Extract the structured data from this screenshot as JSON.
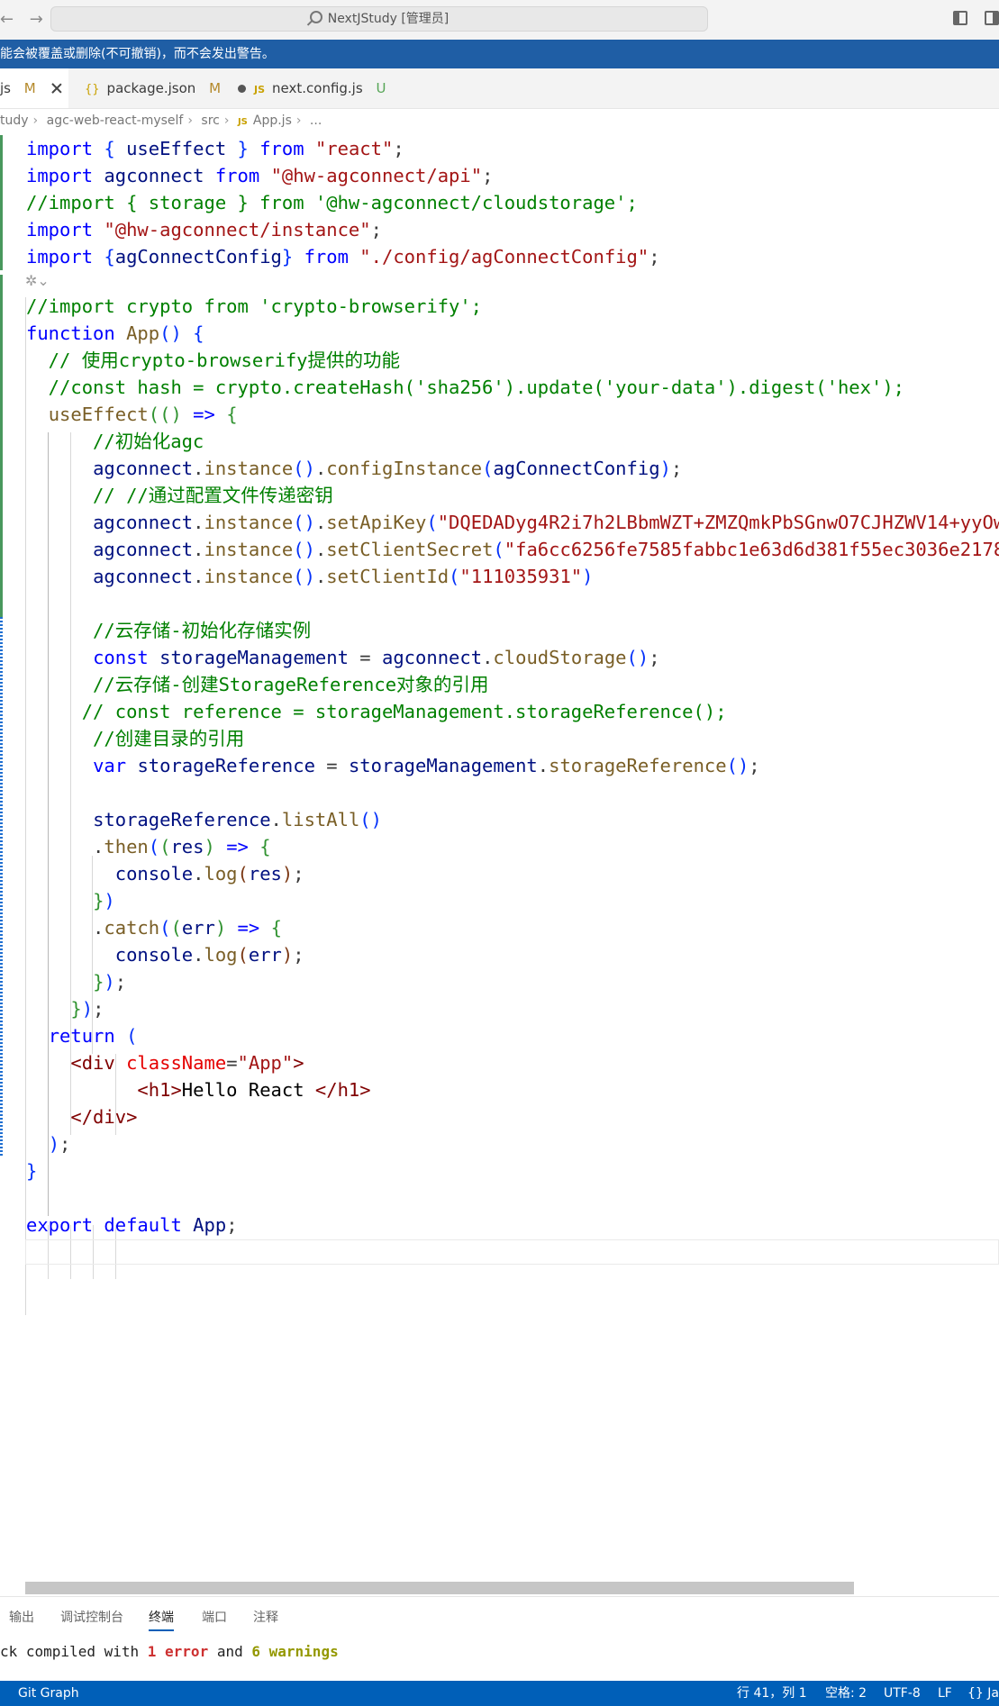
{
  "titlebar": {
    "search_text": "NextJStudy [管理员]"
  },
  "banner": {
    "text": "能会被覆盖或删除(不可撤销)，而不会发出警告。"
  },
  "tabs": [
    {
      "label": "js",
      "status": "M"
    },
    {
      "label": "package.json",
      "status": "M"
    },
    {
      "label": "next.config.js",
      "status": "U"
    }
  ],
  "breadcrumb": {
    "parts": [
      "tudy",
      "agc-web-react-myself",
      "src",
      "App.js",
      "..."
    ],
    "file_badge": "JS"
  },
  "code": [
    "import { useEffect } from \"react\";",
    "import agconnect from \"@hw-agconnect/api\";",
    "//import { storage } from '@hw-agconnect/cloudstorage';",
    "import \"@hw-agconnect/instance\";",
    "import {agConnectConfig} from \"./config/agConnectConfig\";",
    "//import crypto from 'crypto-browserify';",
    "function App() {",
    "  // 使用crypto-browserify提供的功能",
    "  //const hash = crypto.createHash('sha256').update('your-data').digest('hex');",
    "  useEffect(() => {",
    "      //初始化agc",
    "      agconnect.instance().configInstance(agConnectConfig);",
    "      // //通过配置文件传递密钥",
    "      agconnect.instance().setApiKey(\"DQEDADyg4R2i7h2LBbmWZT+ZMZQmkPbSGnwO7CJHZWV14+yyOw",
    "      agconnect.instance().setClientSecret(\"fa6cc6256fe7585fabbc1e63d6d381f55ec3036e2178",
    "      agconnect.instance().setClientId(\"111035931\")",
    "      //云存储-初始化存储实例",
    "      const storageManagement = agconnect.cloudStorage();",
    "      //云存储-创建StorageReference对象的引用",
    "     // const reference = storageManagement.storageReference();",
    "      //创建目录的引用",
    "      var storageReference = storageManagement.storageReference();",
    "      storageReference.listAll()",
    "      .then((res) => {",
    "        console.log(res);",
    "      })",
    "      .catch((err) => {",
    "        console.log(err);",
    "      });",
    "    });",
    "  return (",
    "    <div className=\"App\">",
    "          <h1>Hello React </h1>",
    "    </div>",
    "  );",
    "}",
    "export default App;"
  ],
  "panel": {
    "tabs": [
      "输出",
      "调试控制台",
      "终端",
      "端口",
      "注释"
    ],
    "active_tab": "终端",
    "terminal_prefix": "ck compiled with ",
    "error_text": "1 error",
    "mid_text": " and ",
    "warning_text": "6 warnings"
  },
  "statusbar": {
    "branch": "Git Graph",
    "position": "行 41，列 1",
    "spaces": "空格: 2",
    "encoding": "UTF-8",
    "eol": "LF",
    "language": "{} Ja"
  }
}
